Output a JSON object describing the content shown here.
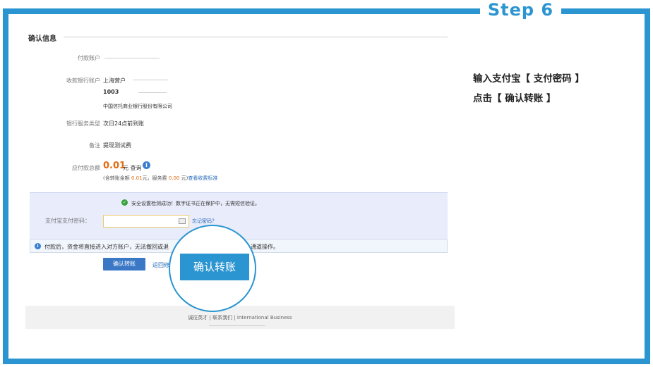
{
  "step": {
    "label": "Step 6"
  },
  "instructions": {
    "line1": "输入支付宝【 支付密码 】",
    "line2": "点击【 确认转账 】"
  },
  "section": {
    "title": "确认信息"
  },
  "fields": {
    "payer_label": "付款账户",
    "receiver_label": "收款银行账户",
    "receiver_city": "上海营户",
    "receiver_no": "1003",
    "receiver_bank": "中国信托商业银行股份有限公司",
    "service_label": "银行服务类型",
    "service_value": "次日24点前到账",
    "remark_label": "备注",
    "remark_value": "提现测试费",
    "amount_label": "应付款总额",
    "amount_value": "0.01",
    "amount_unit": "元",
    "amount_suffix": "查询",
    "fee_prefix": "(含转账金额 ",
    "fee_amount": "0.01",
    "fee_mid": "元，服务费 ",
    "fee_service": "0.00",
    "fee_end": " 元)",
    "fee_link": "查看收费标准"
  },
  "security": {
    "ok_text": "安全设置检测成功！数字证书正在保护中，无需短信验证。"
  },
  "password": {
    "label": "支付宝支付密码：",
    "forgot": "忘记密码？"
  },
  "warning": {
    "text": "付款后，资金将直接进入对方账户，无法撤回或退",
    "tail": "通道操作。"
  },
  "actions": {
    "confirm": "确认转账",
    "back": "返回修"
  },
  "footer": {
    "links": "诚征英才  |  联系我们  |  International Business"
  },
  "zoom": {
    "label": "确认转账"
  },
  "colors": {
    "accent": "#2b95d1",
    "amount": "#e46b10",
    "button": "#3a78c6"
  }
}
